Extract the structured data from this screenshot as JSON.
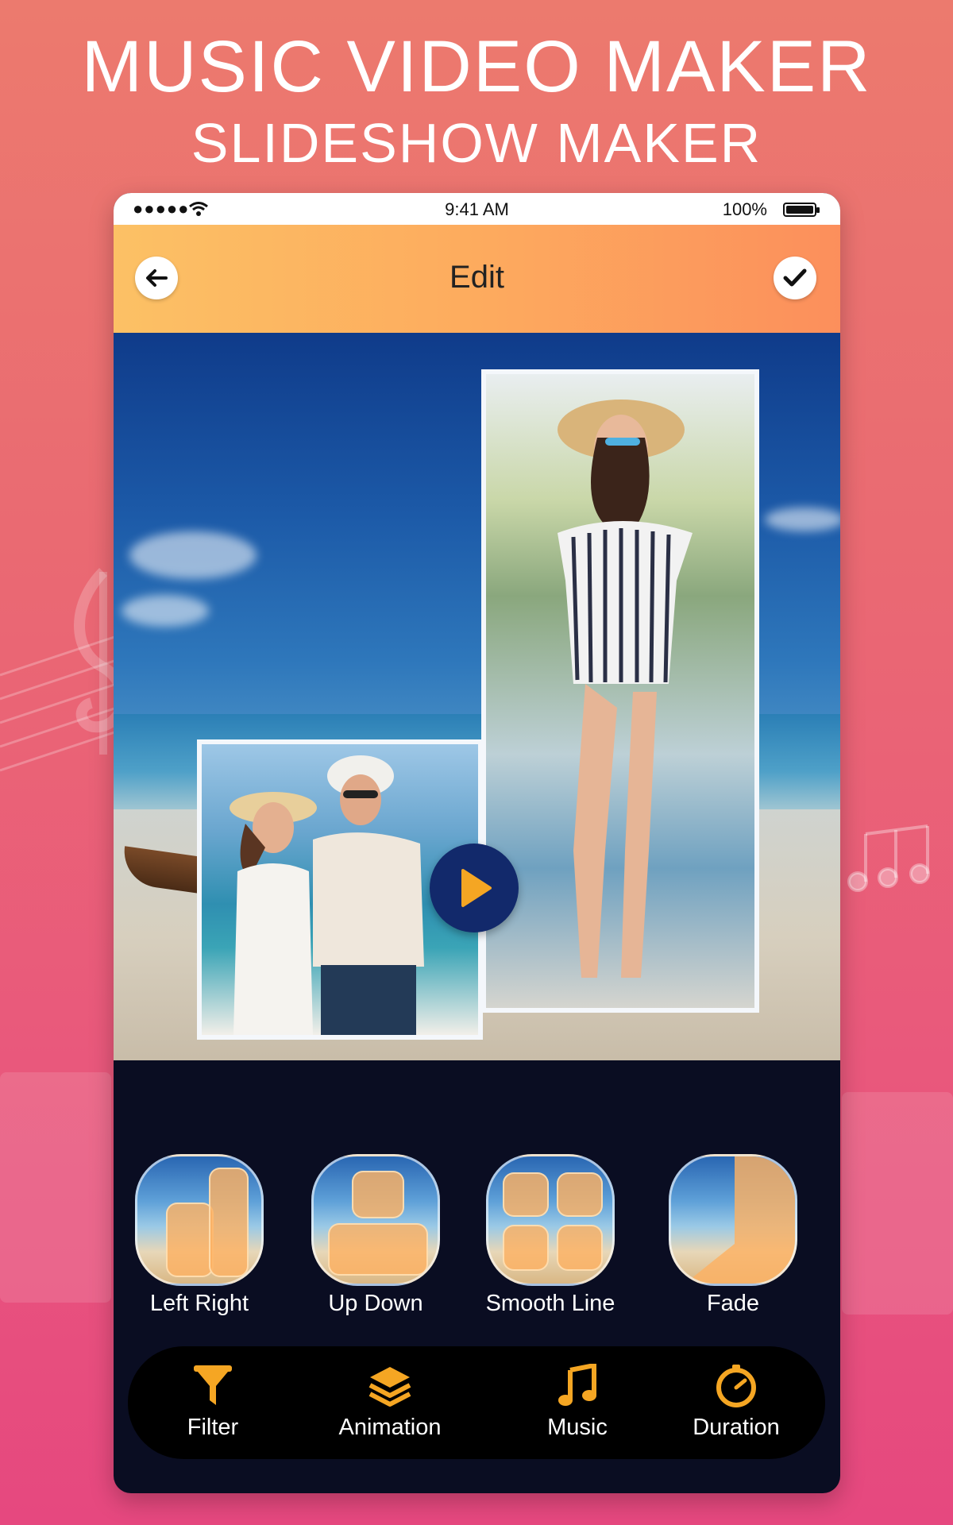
{
  "headline": {
    "line1": "MUSIC VIDEO MAKER",
    "line2": "SLIDESHOW MAKER"
  },
  "status_bar": {
    "signal": "●●●●●",
    "time": "9:41 AM",
    "battery": "100%",
    "battery_level": 1.0
  },
  "app_bar": {
    "title": "Edit",
    "back_icon": "arrow-left-icon",
    "done_icon": "checkmark-icon"
  },
  "preview": {
    "play_icon": "play-icon"
  },
  "transitions": [
    {
      "label": "Left Right"
    },
    {
      "label": "Up Down"
    },
    {
      "label": "Smooth Line"
    },
    {
      "label": "Fade"
    }
  ],
  "bottom_nav": [
    {
      "label": "Filter",
      "icon": "funnel-icon"
    },
    {
      "label": "Animation",
      "icon": "layers-icon"
    },
    {
      "label": "Music",
      "icon": "music-note-icon"
    },
    {
      "label": "Duration",
      "icon": "timer-icon"
    }
  ],
  "colors": {
    "accent": "#f5a623",
    "app_bar_start": "#fcc165",
    "app_bar_end": "#fc8f5c",
    "play_button": "#12296b",
    "panel": "#0a0d22"
  }
}
